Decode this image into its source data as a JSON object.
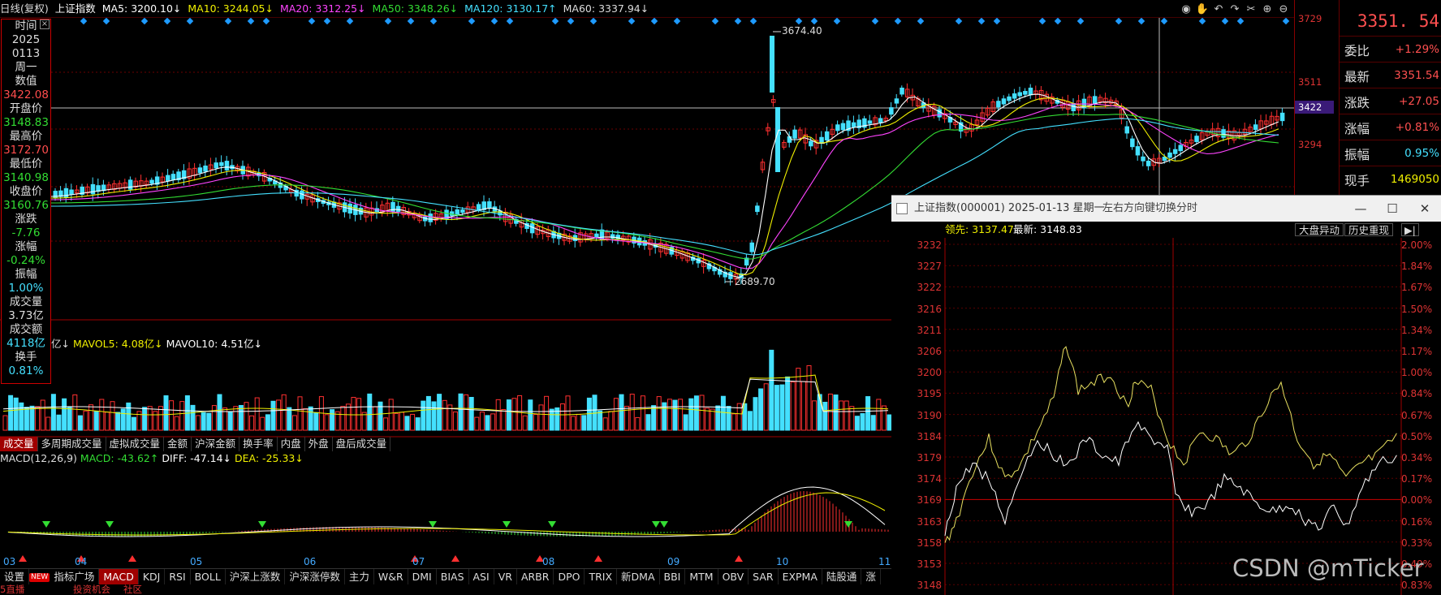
{
  "ma_bar": {
    "mode": "日线(复权)",
    "symbol": "上证指数",
    "ma5": "MA5: 3200.10↓",
    "ma10": "MA10: 3244.05↓",
    "ma20": "MA20: 3312.25↓",
    "ma50": "MA50: 3348.26↓",
    "ma120": "MA120: 3130.17↑",
    "ma60": "MA60: 3337.94↓"
  },
  "toolbar_icons": [
    "eye-icon",
    "hand-icon",
    "undo-icon",
    "scissors-icon",
    "settings-icon",
    "zoom-in-icon",
    "zoom-out-icon"
  ],
  "price_axis": {
    "ticks": [
      "3729",
      "3511",
      "3294"
    ],
    "crosshair": "3422"
  },
  "quote": {
    "price": "3351. 54",
    "rows": [
      {
        "label": "委比",
        "value": "+1.29%",
        "color": "#ff5050"
      },
      {
        "label": "最新",
        "value": "3351.54",
        "color": "#ff5050"
      },
      {
        "label": "涨跌",
        "value": "+27.05",
        "color": "#ff5050"
      },
      {
        "label": "涨幅",
        "value": "+0.81%",
        "color": "#ff5050"
      },
      {
        "label": "振幅",
        "value": "0.95%",
        "color": "#44e0ff"
      },
      {
        "label": "现手",
        "value": "1469050",
        "color": "#f0f000"
      }
    ]
  },
  "info_box": {
    "rows": [
      {
        "label": "时间",
        "value": null
      },
      {
        "label": "2025",
        "value": null
      },
      {
        "label": "0113",
        "value": null
      },
      {
        "label": "周一",
        "value": null
      },
      {
        "label": "数值",
        "value": "3422.08",
        "color": "#ff4d4d"
      },
      {
        "label": "开盘价",
        "value": "3148.83",
        "color": "#33dd33"
      },
      {
        "label": "最高价",
        "value": "3172.70",
        "color": "#ff4d4d"
      },
      {
        "label": "最低价",
        "value": "3140.98",
        "color": "#33dd33"
      },
      {
        "label": "收盘价",
        "value": "3160.76",
        "color": "#33dd33"
      },
      {
        "label": "涨跌",
        "value": "-7.76",
        "color": "#33dd33"
      },
      {
        "label": "涨幅",
        "value": "-0.24%",
        "color": "#33dd33"
      },
      {
        "label": "振幅",
        "value": "1.00%",
        "color": "#44e0ff"
      },
      {
        "label": "成交量",
        "value": "3.73亿",
        "color": "#ddd"
      },
      {
        "label": "成交额",
        "value": "4118亿",
        "color": "#44e0ff"
      },
      {
        "label": "换手",
        "value": "0.81%",
        "color": "#44e0ff"
      }
    ]
  },
  "annotations": {
    "high": "3674.40",
    "low": "2689.70"
  },
  "volume": {
    "header_prefix": "亿↓",
    "mavol5": "MAVOL5: 4.08亿↓",
    "mavol10": "MAVOL10: 4.51亿↓"
  },
  "sub_tabs": [
    "成交量",
    "多周期成交量",
    "虚拟成交量",
    "金额",
    "沪深金额",
    "换手率",
    "内盘",
    "外盘",
    "盘后成交量"
  ],
  "macd": {
    "name": "MACD(12,26,9)",
    "macd": "MACD: -43.62↑",
    "diff": "DIFF: -47.14↓",
    "dea": "DEA: -25.33↓"
  },
  "months": [
    "03",
    "04",
    "05",
    "06",
    "07",
    "08",
    "09",
    "10",
    "11"
  ],
  "bottom_tabs": [
    "设置",
    "指标广场",
    "MACD",
    "KDJ",
    "RSI",
    "BOLL",
    "沪深上涨数",
    "沪深涨停数",
    "主力",
    "W&R",
    "DMI",
    "BIAS",
    "ASI",
    "VR",
    "ARBR",
    "DPO",
    "TRIX",
    "新DMA",
    "BBI",
    "MTM",
    "OBV",
    "SAR",
    "EXPMA",
    "陆股通",
    "涨"
  ],
  "new_badge": "NEW",
  "bottom_row2": [
    "5直播",
    "投资机会",
    "社区"
  ],
  "popup": {
    "title": "上证指数(000001) 2025-01-13 星期一",
    "hint": "左右方向键切换分时",
    "lead": "领先: 3137.47",
    "latest": "最新: 3148.83",
    "btn_market": "大盘异动",
    "btn_history": "历史重现",
    "left_axis": [
      "3232",
      "3227",
      "3222",
      "3216",
      "3211",
      "3206",
      "3200",
      "3195",
      "3190",
      "3184",
      "3179",
      "3174",
      "3169",
      "3163",
      "3158",
      "3153",
      "3148"
    ],
    "right_axis": [
      "2.00%",
      "1.84%",
      "1.67%",
      "1.50%",
      "1.34%",
      "1.17%",
      "1.00%",
      "0.84%",
      "0.67%",
      "0.50%",
      "0.34%",
      "0.17%",
      "0.00%",
      "0.16%",
      "0.33%",
      "0.49%",
      "0.83%"
    ]
  },
  "watermark": "CSDN @mTicker"
}
